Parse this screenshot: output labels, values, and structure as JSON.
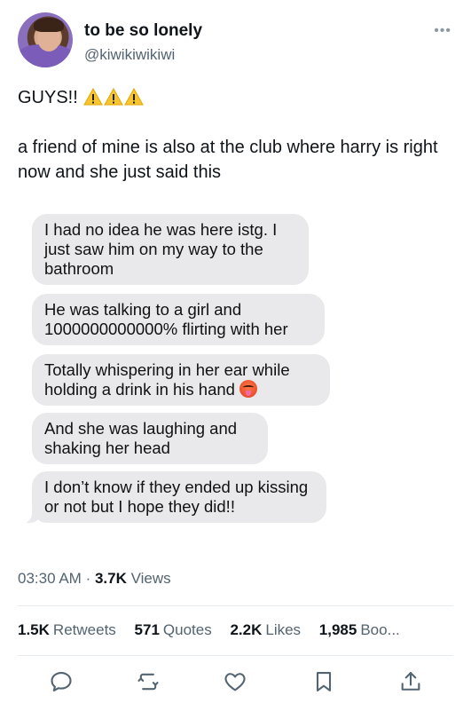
{
  "tweet": {
    "display_name": "to be so lonely",
    "handle": "@kiwikiwikiwi",
    "more_icon": "more-horizontal-icon",
    "line1": "GUYS!!",
    "warning_emoji_count": 3,
    "line2": "a friend of mine is also at the club where harry is right now and she just said this",
    "chat_messages": [
      "I had no idea he was here istg. I just saw him on my way to the bathroom",
      "He was talking to a girl and 1000000000000% flirting with her",
      "Totally whispering in her ear while holding a drink in his hand",
      "And she was laughing and shaking her head",
      "I don’t know if they ended up kissing or not but I hope they did!!"
    ],
    "time": "03:30 AM",
    "separator": "·",
    "views_count": "3.7K",
    "views_label": "Views"
  },
  "stats": {
    "retweets_count": "1.5K",
    "retweets_label": "Retweets",
    "quotes_count": "571",
    "quotes_label": "Quotes",
    "likes_count": "2.2K",
    "likes_label": "Likes",
    "bookmarks_count": "1,985",
    "bookmarks_label": "Boo..."
  },
  "actions": [
    "reply-icon",
    "retweet-icon",
    "like-icon",
    "bookmark-icon",
    "share-icon"
  ],
  "colors": {
    "secondary_text": "#536471",
    "bubble": "#e9e9eb",
    "divider": "#e6ecf0"
  }
}
